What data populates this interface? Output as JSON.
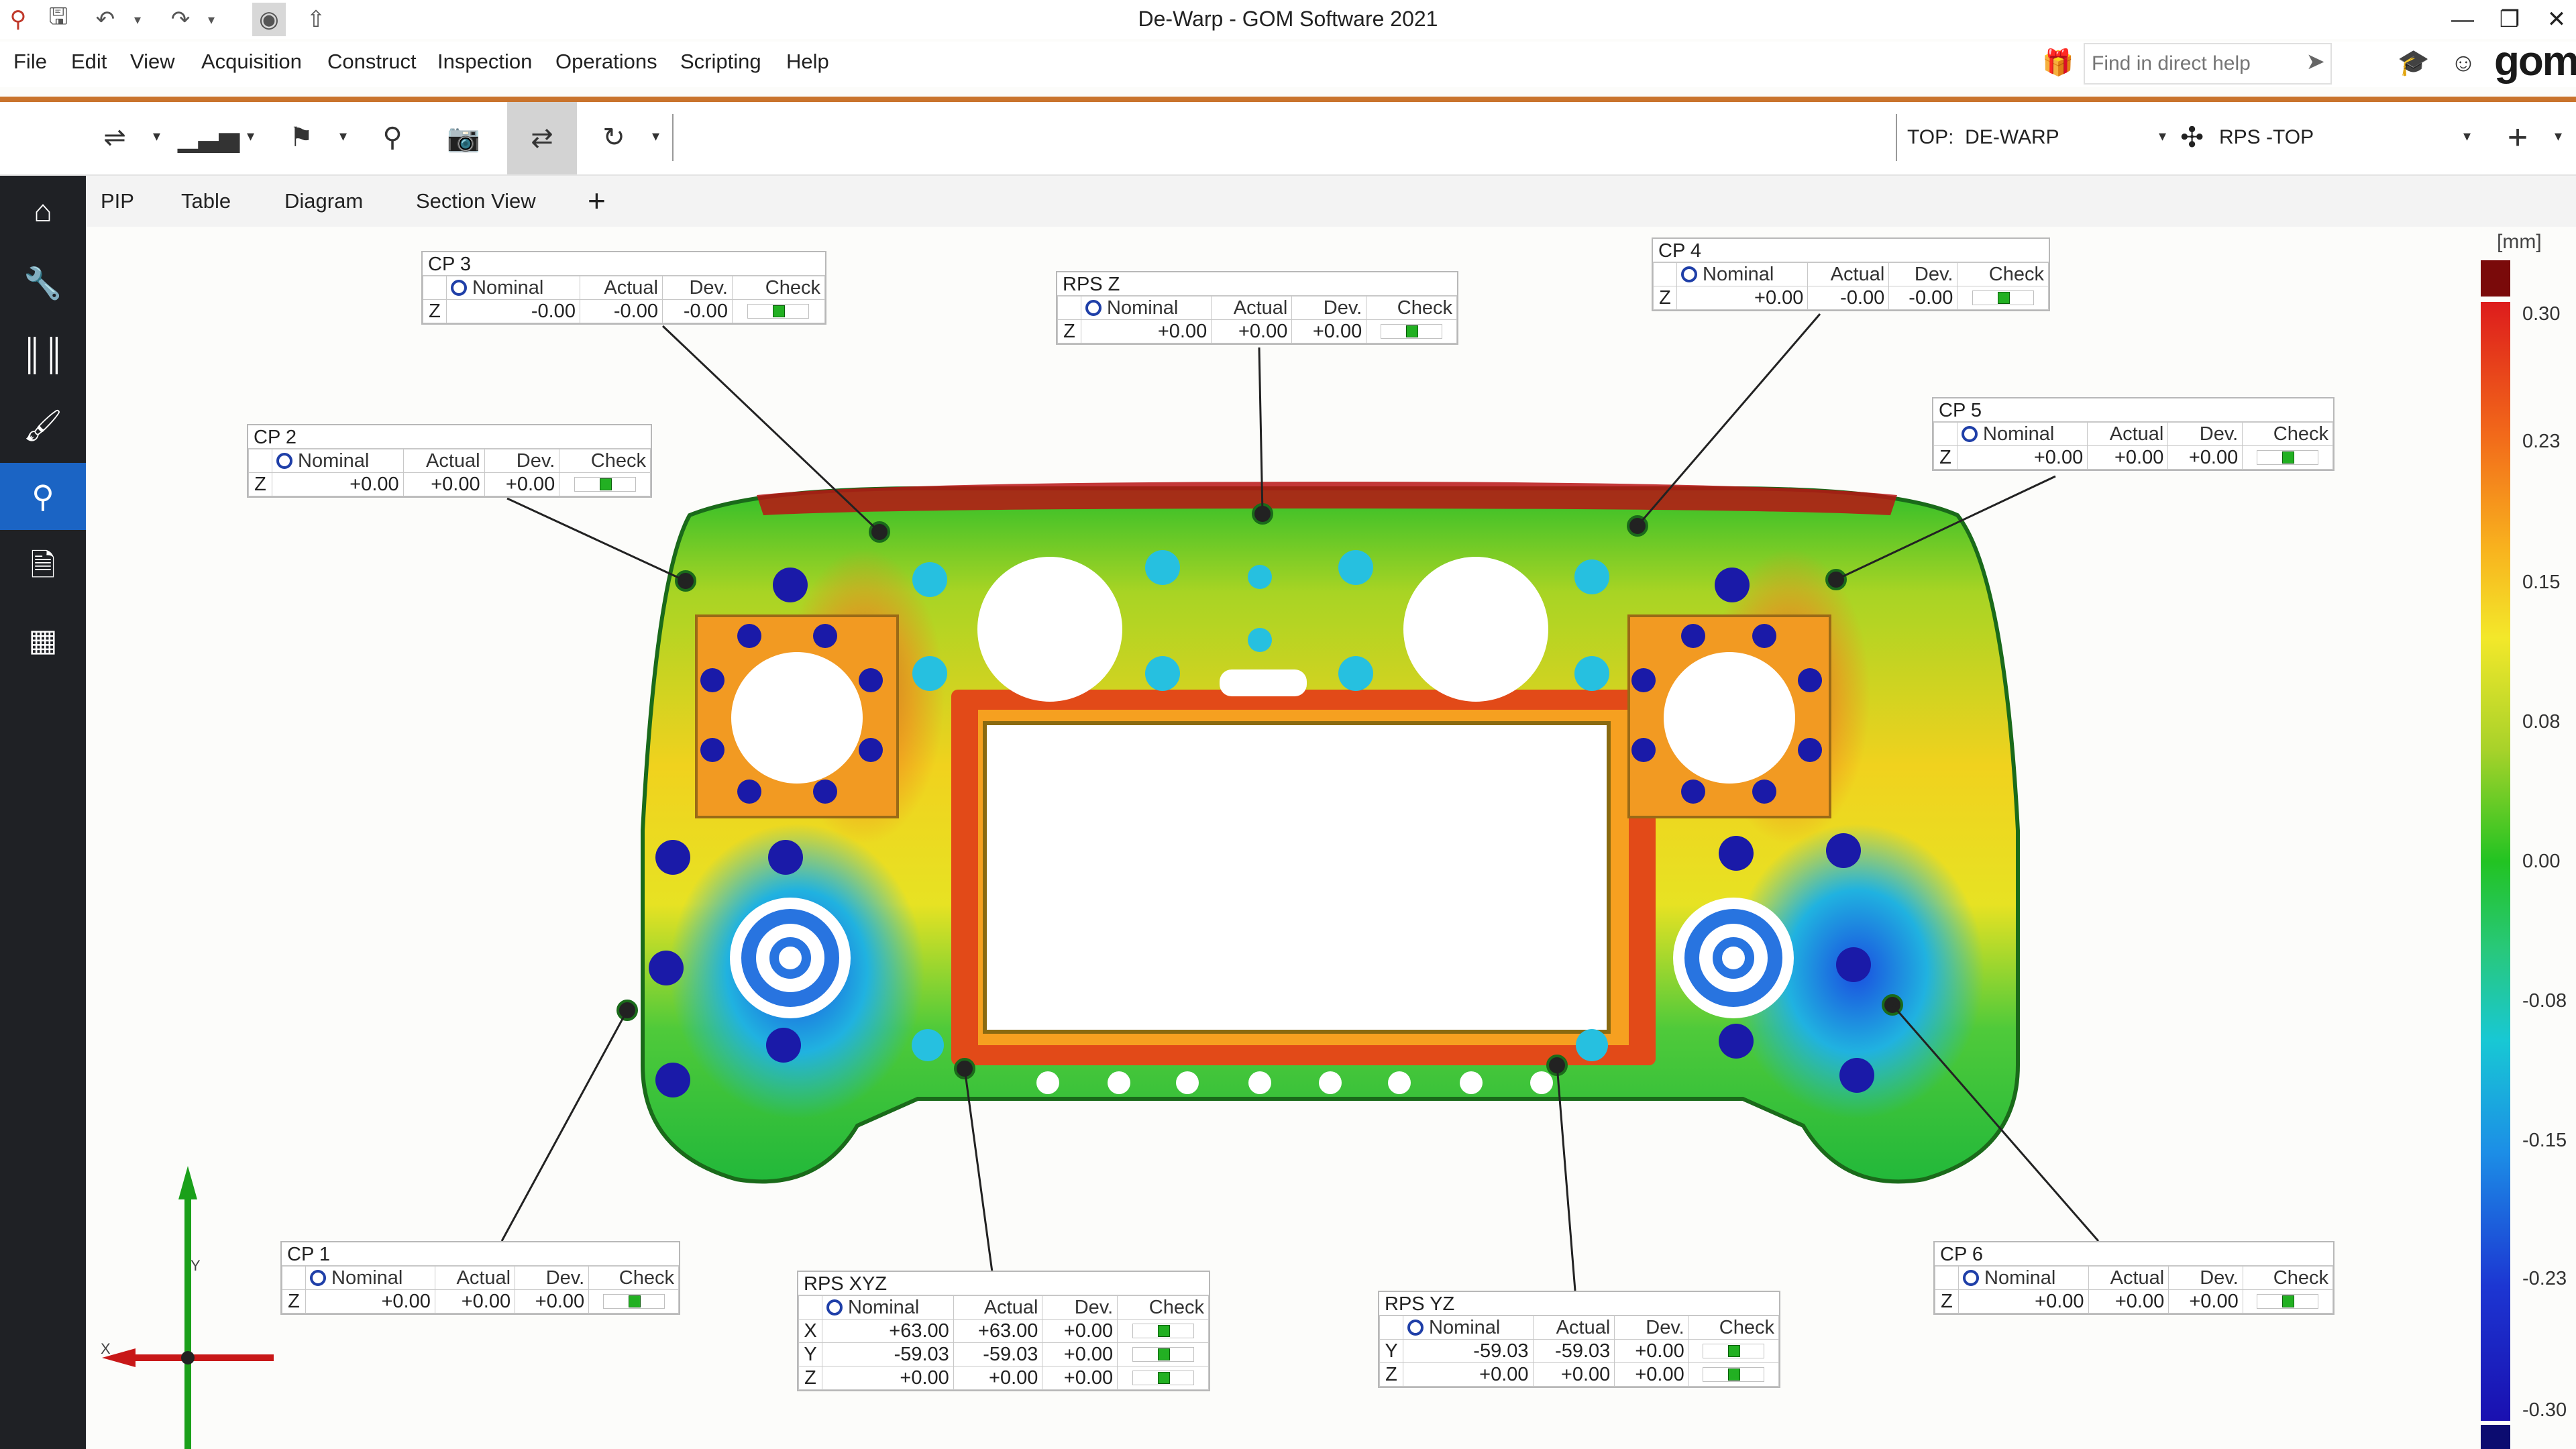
{
  "window": {
    "title": "De-Warp - GOM Software 2021"
  },
  "quick_access": [
    "search-app-icon",
    "save-icon",
    "undo-icon",
    "redo-icon",
    "bookmark-icon",
    "export-icon"
  ],
  "menu": [
    "File",
    "Edit",
    "View",
    "Acquisition",
    "Construct",
    "Inspection",
    "Operations",
    "Scripting",
    "Help"
  ],
  "help_search": {
    "placeholder": "Find in direct help"
  },
  "logo": "gom",
  "toolbar": {
    "alignment": {
      "prefix": "TOP:",
      "value": "DE-WARP"
    },
    "rps": {
      "value": "RPS -TOP"
    }
  },
  "sidebar": [
    "home-icon",
    "wrench-icon",
    "barcode-icon",
    "brush-icon",
    "inspect-search-icon",
    "report-icon",
    "pattern-icon"
  ],
  "tabs": [
    "PIP",
    "Table",
    "Diagram",
    "Section View"
  ],
  "tab_add": "+",
  "colorbar": {
    "unit": "[mm]",
    "ticks": [
      "0.30",
      "0.23",
      "0.15",
      "0.08",
      "0.00",
      "-0.08",
      "-0.15",
      "-0.23",
      "-0.30"
    ]
  },
  "table_headers": {
    "nominal": "Nominal",
    "actual": "Actual",
    "dev": "Dev.",
    "check": "Check"
  },
  "labels": {
    "cp3": {
      "title": "CP 3",
      "rows": [
        {
          "axis": "Z",
          "nominal": "-0.00",
          "actual": "-0.00",
          "dev": "-0.00"
        }
      ]
    },
    "rpsz": {
      "title": "RPS Z",
      "rows": [
        {
          "axis": "Z",
          "nominal": "+0.00",
          "actual": "+0.00",
          "dev": "+0.00"
        }
      ]
    },
    "cp4": {
      "title": "CP 4",
      "rows": [
        {
          "axis": "Z",
          "nominal": "+0.00",
          "actual": "-0.00",
          "dev": "-0.00"
        }
      ]
    },
    "cp2": {
      "title": "CP 2",
      "rows": [
        {
          "axis": "Z",
          "nominal": "+0.00",
          "actual": "+0.00",
          "dev": "+0.00"
        }
      ]
    },
    "cp5": {
      "title": "CP 5",
      "rows": [
        {
          "axis": "Z",
          "nominal": "+0.00",
          "actual": "+0.00",
          "dev": "+0.00"
        }
      ]
    },
    "cp1": {
      "title": "CP 1",
      "rows": [
        {
          "axis": "Z",
          "nominal": "+0.00",
          "actual": "+0.00",
          "dev": "+0.00"
        }
      ]
    },
    "rpsxyz": {
      "title": "RPS XYZ",
      "rows": [
        {
          "axis": "X",
          "nominal": "+63.00",
          "actual": "+63.00",
          "dev": "+0.00"
        },
        {
          "axis": "Y",
          "nominal": "-59.03",
          "actual": "-59.03",
          "dev": "+0.00"
        },
        {
          "axis": "Z",
          "nominal": "+0.00",
          "actual": "+0.00",
          "dev": "+0.00"
        }
      ]
    },
    "rpsyz": {
      "title": "RPS YZ",
      "rows": [
        {
          "axis": "Y",
          "nominal": "-59.03",
          "actual": "-59.03",
          "dev": "+0.00"
        },
        {
          "axis": "Z",
          "nominal": "+0.00",
          "actual": "+0.00",
          "dev": "+0.00"
        }
      ]
    },
    "cp6": {
      "title": "CP 6",
      "rows": [
        {
          "axis": "Z",
          "nominal": "+0.00",
          "actual": "+0.00",
          "dev": "+0.00"
        }
      ]
    }
  },
  "axes": {
    "y": "Y",
    "x": "X"
  }
}
